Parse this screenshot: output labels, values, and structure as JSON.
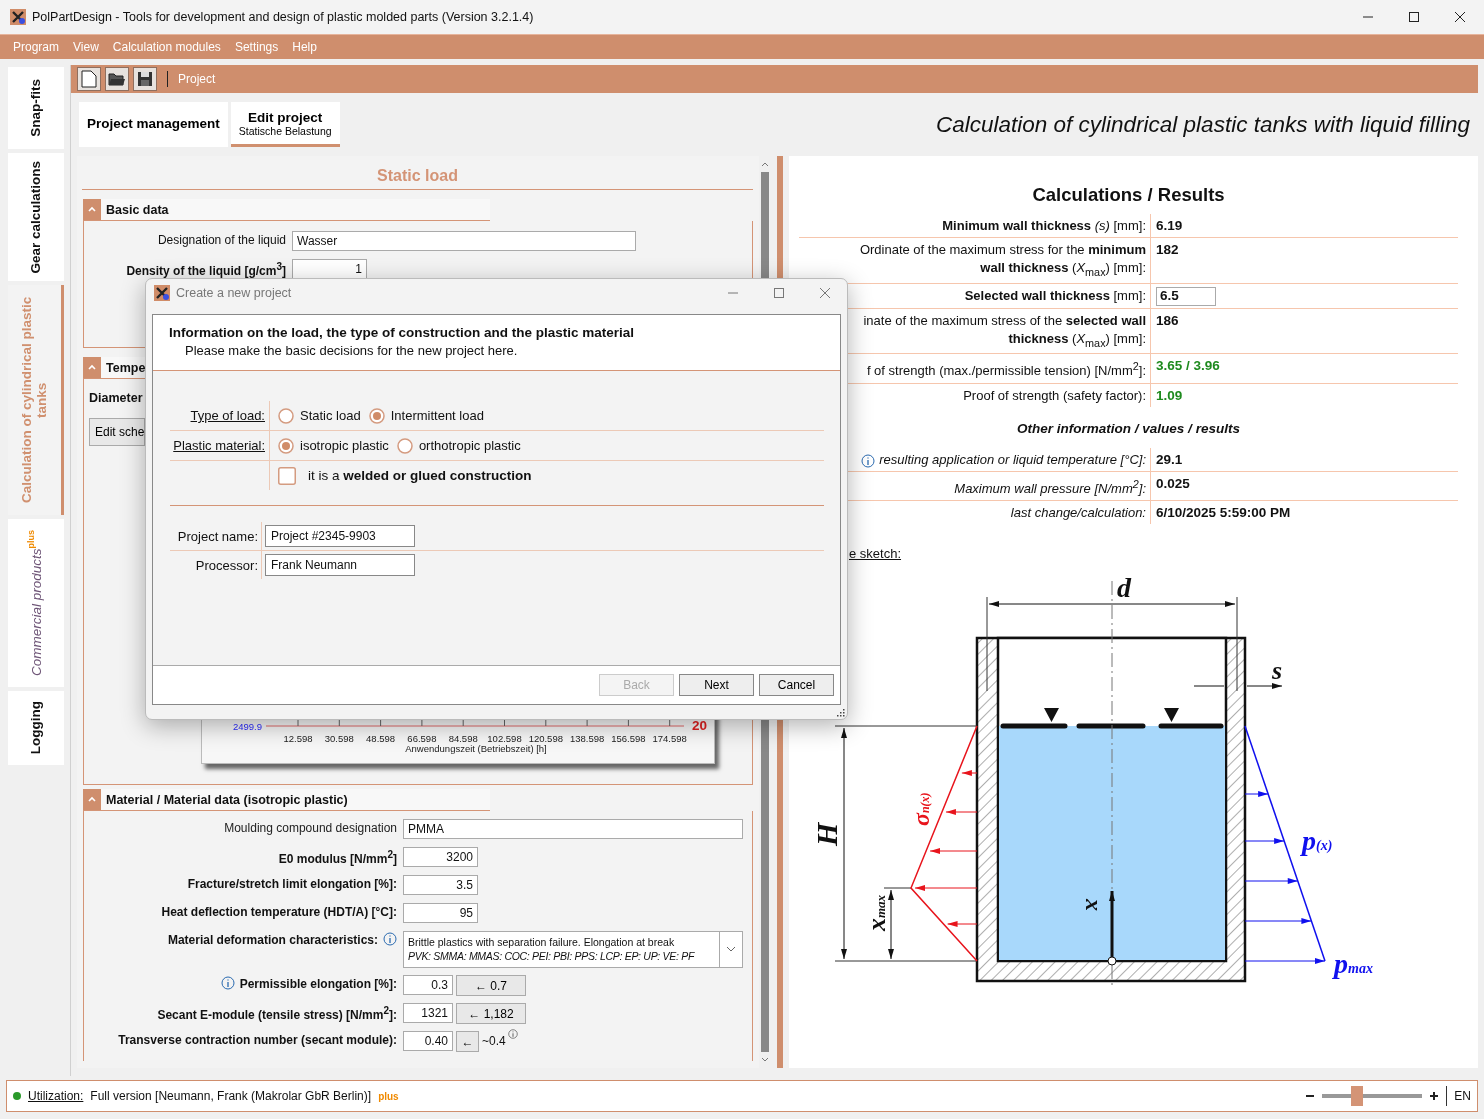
{
  "window": {
    "title": "PolPartDesign - Tools for development and design of plastic molded parts (Version 3.2.1.4)"
  },
  "menu": [
    "Program",
    "View",
    "Calculation modules",
    "Settings",
    "Help"
  ],
  "side_tabs": [
    {
      "label": "Snap-fits",
      "kind": "plain",
      "selected": false
    },
    {
      "label": "Gear calculations",
      "kind": "plain",
      "selected": false
    },
    {
      "label": "Calculation of cylindrical plastic tanks",
      "kind": "plain",
      "selected": true
    },
    {
      "label": "Commercial products",
      "kind": "plus",
      "badge": "plus",
      "selected": false
    },
    {
      "label": "Logging",
      "kind": "plain",
      "selected": false
    }
  ],
  "toolbar": {
    "breadcrumb": "Project"
  },
  "tabs": [
    {
      "label": "Project management",
      "selected": false
    },
    {
      "label": "Edit project",
      "sublabel": "Statische Belastung",
      "selected": true
    }
  ],
  "page_title": "Calculation of cylindrical plastic tanks with liquid filling",
  "input_panel": {
    "title": "Static load",
    "basic_data": {
      "title": "Basic data",
      "expanded": true,
      "rows": [
        {
          "label": "Designation of the liquid",
          "bold": false,
          "kind": "text",
          "value": "Wasser"
        },
        {
          "label": "Density of the liquid [g/cm$^{3}$]",
          "bold": true,
          "kind": "number",
          "value": "1"
        }
      ]
    },
    "temperature": {
      "title": "Tempe",
      "expanded": true,
      "label": "Diameter",
      "button": "Edit sche",
      "chart": {
        "left_value": "2499.9",
        "right_value": "20",
        "xticks": [
          "12.598",
          "30.598",
          "48.598",
          "66.598",
          "84.598",
          "102.598",
          "120.598",
          "138.598",
          "156.598",
          "174.598"
        ],
        "xlabel": "Anwendungszeit (Betriebszeit) [h]"
      }
    },
    "material": {
      "title": "Material / Material data (isotropic plastic)",
      "expanded": true,
      "rows": [
        {
          "label": "Moulding compound designation",
          "bold": false,
          "kind": "text",
          "value": "PMMA"
        },
        {
          "label": "E0 modulus [N/mm$^{2}$]",
          "bold": true,
          "kind": "number",
          "value": "3200"
        },
        {
          "label": "Fracture/stretch limit elongation [%]:",
          "bold": true,
          "kind": "number",
          "value": "3.5"
        },
        {
          "label": "Heat deflection temperature (HDT/A) [°C]:",
          "bold": true,
          "kind": "number",
          "value": "95"
        },
        {
          "label": "Material deformation characteristics:",
          "bold": true,
          "info_after": true,
          "kind": "combo",
          "value": "Brittle plastics with separation failure. Elongation at break",
          "detail": "PVK: SMMA: MMAS: COC: PEI: PBI: PPS: LCP: EP: UP: VE: PF"
        },
        {
          "label": "Permissible elongation [%]:",
          "bold": true,
          "info_before": true,
          "kind": "adopt",
          "value": "0.3",
          "button": "← 0.7"
        },
        {
          "label": "Secant E-module (tensile stress) [N/mm$^{2}$]:",
          "bold": true,
          "kind": "adopt",
          "value": "1321",
          "button": "← 1,182"
        },
        {
          "label": "Transverse contraction number (secant module):",
          "bold": true,
          "kind": "adopt_small",
          "value": "0.40",
          "button": "←",
          "note": "~0.4"
        }
      ]
    }
  },
  "results": {
    "title": "Calculations / Results",
    "rows": [
      {
        "label": "**Minimum wall thickness** *(s)* [mm]:",
        "kind": "text",
        "ok": false,
        "value": "6.19"
      },
      {
        "label": "Ordinate of the maximum stress for the **minimum wall thickness** (*X*$_{max}$) [mm]:",
        "kind": "text",
        "ok": false,
        "value": "182"
      },
      {
        "label": "**Selected wall thickness** [mm]:",
        "kind": "input",
        "value": "6.5"
      },
      {
        "label": "inate of the maximum stress of the **selected wall thickness** (*X*$_{max}$) [mm]:",
        "kind": "text",
        "ok": false,
        "value": "186"
      },
      {
        "label": "f of strength (max./permissible tension) [N/mm$^{2}$]:",
        "kind": "text",
        "ok": true,
        "value": "3.65 / 3.96"
      },
      {
        "label": "Proof of strength (safety factor):",
        "kind": "text",
        "ok": true,
        "value": "1.09"
      }
    ],
    "other_title": "Other information / values / results",
    "other_rows": [
      {
        "label": "resulting application or liquid temperature [°C]:",
        "info": true,
        "value": "29.1"
      },
      {
        "label": "Maximum wall pressure [N/mm$^{2}$]:",
        "info": false,
        "value": "0.025"
      },
      {
        "label": "last change/calculation:",
        "info": false,
        "value": "6/10/2025 5:59:00 PM"
      }
    ],
    "sketch_link": "e sketch:",
    "sketch_labels": [
      {
        "kind": "diameter",
        "main": "d"
      },
      {
        "kind": "wall",
        "main": "s"
      },
      {
        "kind": "height",
        "main": "H"
      },
      {
        "kind": "xmax",
        "main": "x",
        "sub": "max"
      },
      {
        "kind": "stress",
        "main": "σ",
        "sub": "n(x)"
      },
      {
        "kind": "pressure",
        "main": "p",
        "sub": "(x)"
      },
      {
        "kind": "pmax",
        "main": "p",
        "sub": "max"
      },
      {
        "kind": "axis",
        "main": "x"
      }
    ]
  },
  "dialog": {
    "title": "Create a new project",
    "heading": "Information on the load, the type of construction and the plastic material",
    "subheading": "Please make the basic decisions for the new project here.",
    "load_type": {
      "label": "Type of load:",
      "options": [
        {
          "label": "Static load",
          "selected": false
        },
        {
          "label": "Intermittent load",
          "selected": true
        }
      ]
    },
    "plastic": {
      "label": "Plastic material:",
      "options": [
        {
          "label": "isotropic plastic",
          "selected": true
        },
        {
          "label": "orthotropic plastic",
          "selected": false
        }
      ]
    },
    "welded": {
      "label": "it is a **welded or glued construction**",
      "checked": false
    },
    "fields": [
      {
        "label": "Project name:",
        "value": "Project #2345-9903"
      },
      {
        "label": "Processor:",
        "value": "Frank Neumann"
      }
    ],
    "buttons": [
      {
        "label": "Back",
        "disabled": true
      },
      {
        "label": "Next",
        "disabled": false
      },
      {
        "label": "Cancel",
        "disabled": false
      }
    ]
  },
  "status_bar": {
    "online": true,
    "link": "Utilization:",
    "text": "Full version [Neumann, Frank (Makrolar GbR Berlin)]",
    "badge": "plus",
    "zoom": {
      "level": 0.35
    },
    "language": "EN"
  }
}
